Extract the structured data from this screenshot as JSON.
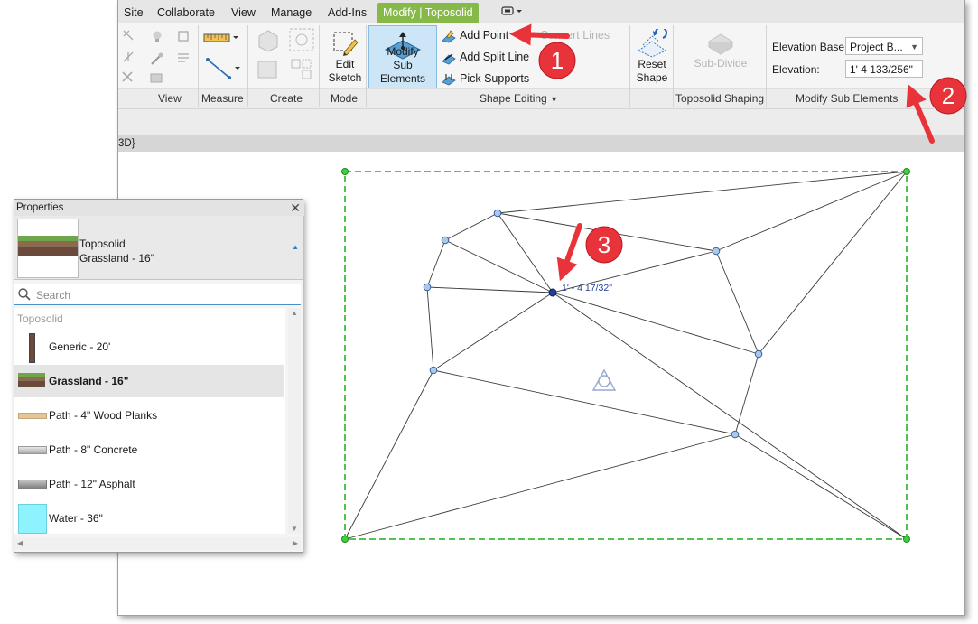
{
  "tabs": [
    {
      "label": "Site",
      "active": false
    },
    {
      "label": "Collaborate",
      "active": false
    },
    {
      "label": "View",
      "active": false
    },
    {
      "label": "Manage",
      "active": false
    },
    {
      "label": "Add-Ins",
      "active": false
    },
    {
      "label": "Modify | Toposolid",
      "active": true
    }
  ],
  "ribbon": {
    "panels": {
      "view": "View",
      "measure": "Measure",
      "create": "Create",
      "mode": "Mode",
      "shape_editing": "Shape Editing",
      "toposolid_shaping": "Toposolid Shaping",
      "modify_sub_elements": "Modify Sub Elements"
    },
    "edit_sketch": [
      "Edit",
      "Sketch"
    ],
    "modify_sub_elements_btn": [
      "Modify",
      "Sub Elements"
    ],
    "add_point": "Add Point",
    "convert_lines": "Convert Lines",
    "add_split_line": "Add Split Line",
    "pick_supports": "Pick Supports",
    "reset_shape": [
      "Reset",
      "Shape"
    ],
    "sub_divide": "Sub-Divide",
    "elevation_base_label": "Elevation Base:",
    "elevation_base_value": "Project B...",
    "elevation_label": "Elevation:",
    "elevation_value": "1'  4 133/256\""
  },
  "view": {
    "header": "3D}",
    "point_label": "1' - 4 17/32\""
  },
  "callouts": [
    "1",
    "2",
    "3"
  ],
  "properties": {
    "title": "Properties",
    "type_line1": "Toposolid",
    "type_line2": "Grassland - 16\"",
    "search_placeholder": "Search",
    "group": "Toposolid",
    "items": [
      {
        "label": "Generic - 20'",
        "selected": false
      },
      {
        "label": "Grassland - 16\"",
        "selected": true
      },
      {
        "label": "Path - 4\" Wood Planks",
        "selected": false
      },
      {
        "label": "Path - 8\" Concrete",
        "selected": false
      },
      {
        "label": "Path - 12\" Asphalt",
        "selected": false
      },
      {
        "label": "Water - 36\"",
        "selected": false
      }
    ]
  },
  "colors": {
    "active_tab": "#86b84a",
    "boundary": "#3dbb3d",
    "callout": "#e8333a",
    "vertex": "#a9c9ec",
    "selected_vertex": "#1f3f9a"
  }
}
